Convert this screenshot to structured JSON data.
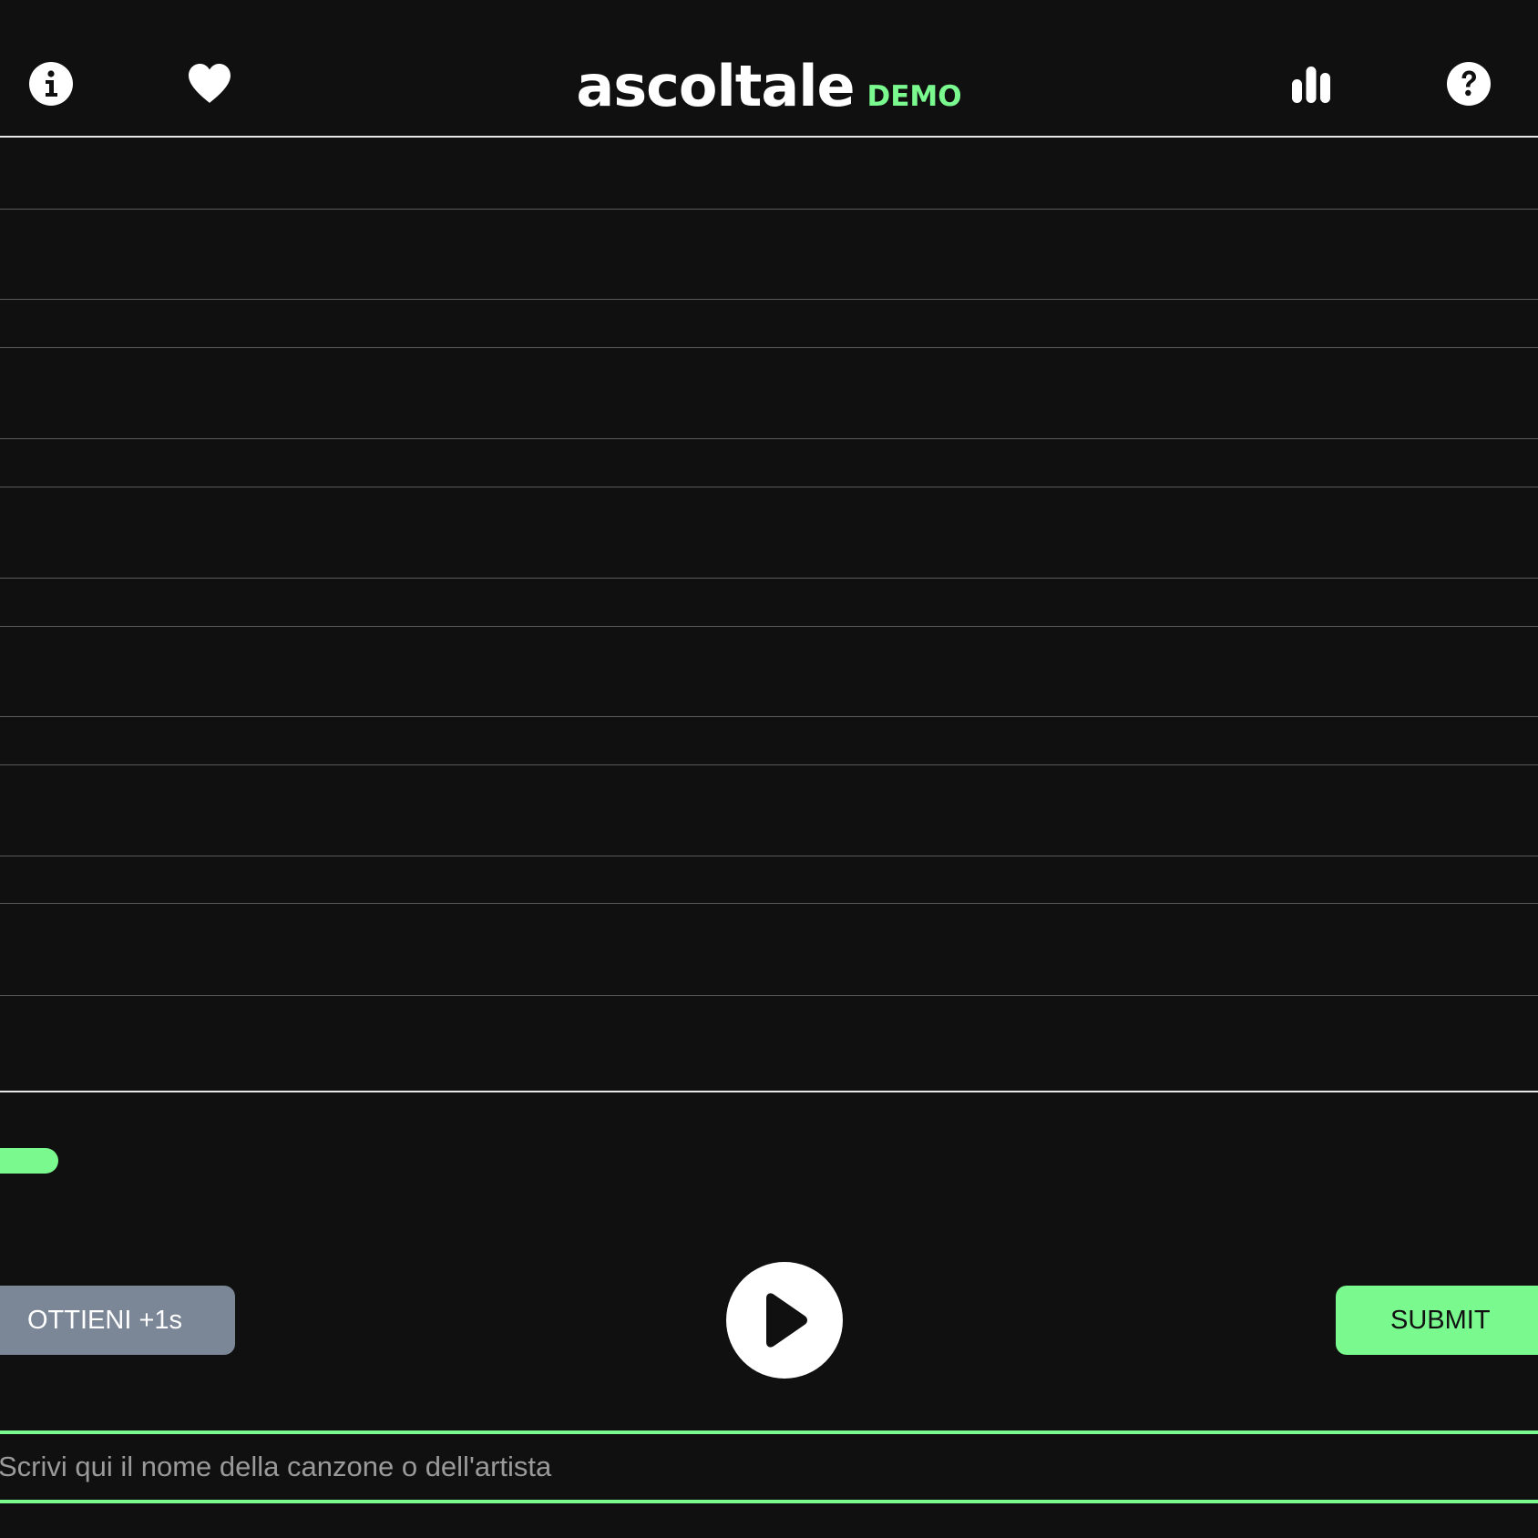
{
  "header": {
    "title": "ascoltale",
    "tag": "DEMO",
    "icons": [
      "info-icon",
      "heart-icon",
      "stats-icon",
      "help-icon"
    ]
  },
  "guesses": {
    "rows": [
      "",
      "",
      "",
      "",
      "",
      ""
    ]
  },
  "progress": {
    "played_fraction": 0.05
  },
  "controls": {
    "skip_label": "OTTIENI +1s",
    "submit_label": "SUBMIT",
    "play_icon": "play-icon"
  },
  "search": {
    "placeholder": "Scrivi qui il nome della canzone o dell'artista",
    "value": ""
  },
  "colors": {
    "background": "#101010",
    "accent": "#79f98e",
    "skip_button": "#7b8796",
    "divider": "#e8e8e8",
    "row_line": "#5a5a5a"
  }
}
